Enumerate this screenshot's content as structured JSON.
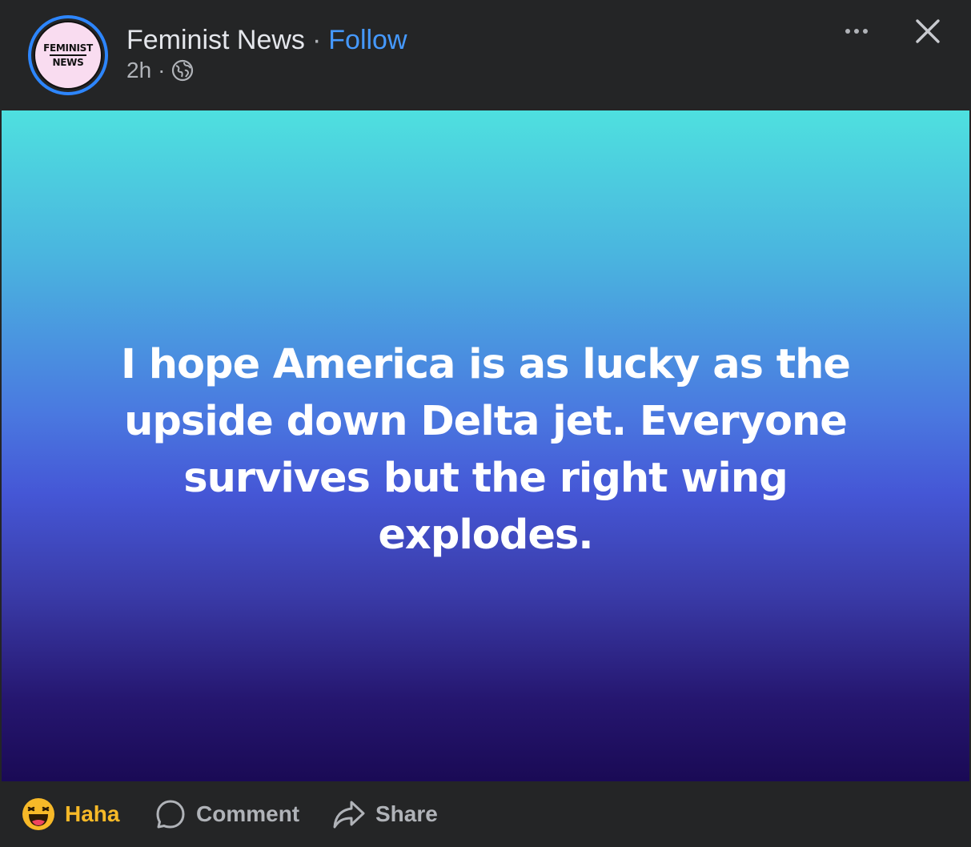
{
  "header": {
    "avatar_text_line1": "FEMINIST",
    "avatar_text_line2": "NEWS",
    "page_name": "Feminist News",
    "separator": "·",
    "follow_label": "Follow",
    "timestamp": "2h",
    "meta_separator": "·",
    "audience_icon": "globe-icon",
    "more_icon": "more-options-icon",
    "close_icon": "close-icon"
  },
  "post": {
    "text": "I hope America is as lucky as the upside down Delta jet. Everyone survives but the right wing explodes.",
    "background_colors": [
      "#4ee0df",
      "#4a79e0",
      "#1a0a55"
    ]
  },
  "footer": {
    "reaction_label": "Haha",
    "reaction_icon": "haha-emoji-icon",
    "reaction_color": "#f7b928",
    "comment_label": "Comment",
    "comment_icon": "comment-icon",
    "share_label": "Share",
    "share_icon": "share-icon"
  },
  "colors": {
    "background": "#242526",
    "follow": "#4599ff",
    "avatar_ring": "#2d86ff"
  }
}
